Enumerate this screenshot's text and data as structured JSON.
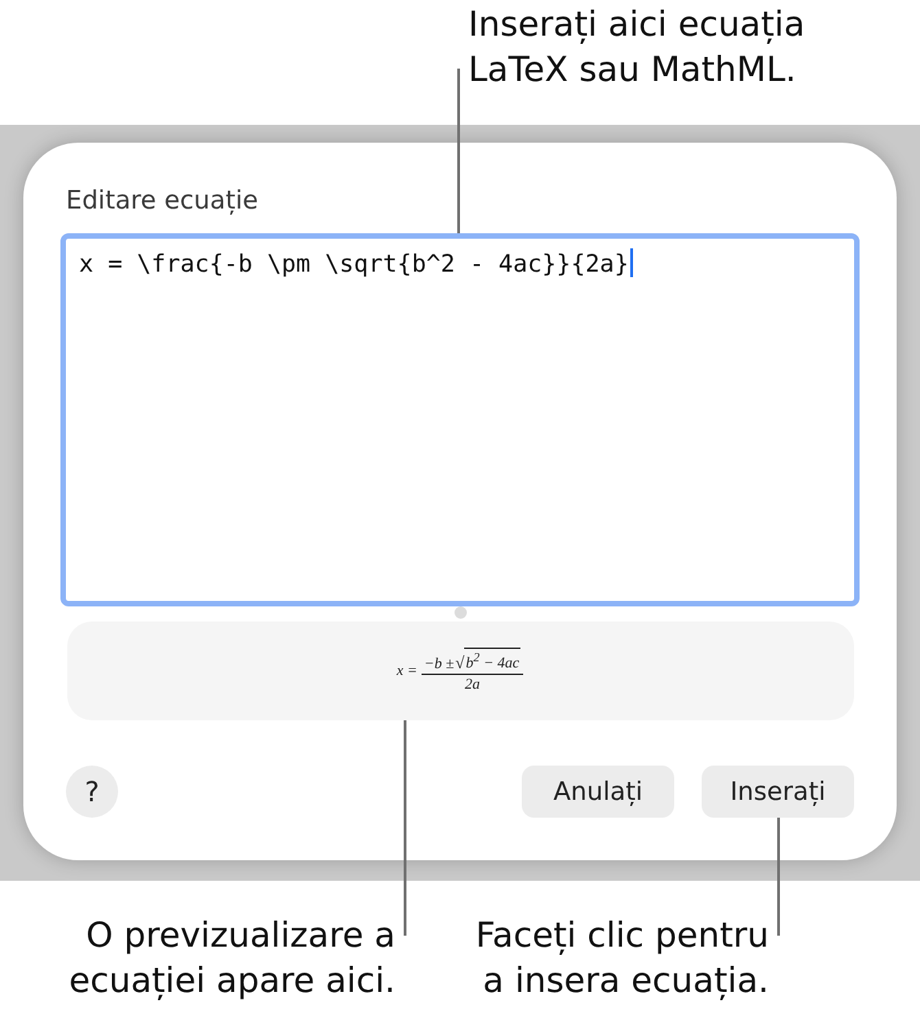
{
  "top_callout": {
    "text": "Inserați aici ecuația LaTeX sau MathML."
  },
  "dialog": {
    "editor": {
      "label": "Editare ecuație",
      "value": "x = \\frac{-b \\pm \\sqrt{b^2 - 4ac}}{2a}",
      "focused": true
    },
    "preview": {
      "lhs": "x =",
      "numerator": "−b ±",
      "radical": "√",
      "radicand": "b$^{2}$ − 4ac",
      "denominator": "2a"
    },
    "help": {
      "label": "?"
    },
    "buttons": [
      {
        "label": "Anulați"
      },
      {
        "label": "Inserați"
      }
    ]
  },
  "bottom_callouts": [
    {
      "text": "O previzualizare a ecuației apare aici."
    },
    {
      "text": "Faceți clic pentru a insera ecuația."
    }
  ]
}
